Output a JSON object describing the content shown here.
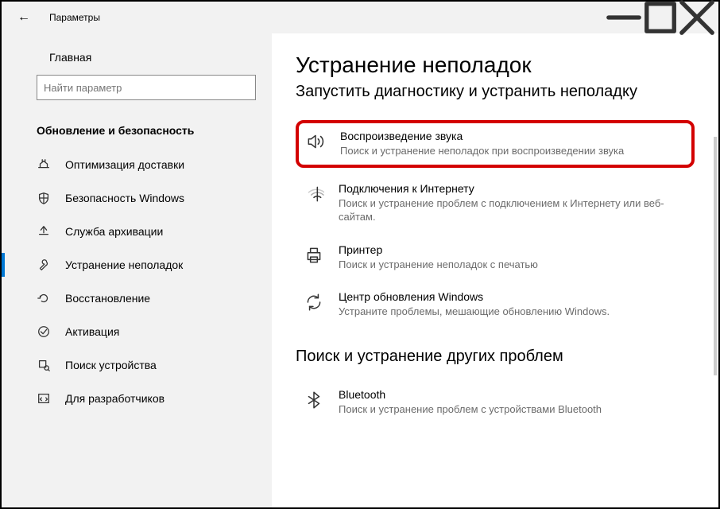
{
  "titlebar": {
    "title": "Параметры"
  },
  "sidebar": {
    "home_label": "Главная",
    "search_placeholder": "Найти параметр",
    "section": "Обновление и безопасность",
    "items": [
      {
        "label": "Оптимизация доставки"
      },
      {
        "label": "Безопасность Windows"
      },
      {
        "label": "Служба архивации"
      },
      {
        "label": "Устранение неполадок"
      },
      {
        "label": "Восстановление"
      },
      {
        "label": "Активация"
      },
      {
        "label": "Поиск устройства"
      },
      {
        "label": "Для разработчиков"
      }
    ]
  },
  "main": {
    "title": "Устранение неполадок",
    "subtitle": "Запустить диагностику и устранить неполадку",
    "troubleshooters": [
      {
        "title": "Воспроизведение звука",
        "desc": "Поиск и устранение неполадок при воспроизведении звука"
      },
      {
        "title": "Подключения к Интернету",
        "desc": "Поиск и устранение проблем с подключением к Интернету или веб-сайтам."
      },
      {
        "title": "Принтер",
        "desc": "Поиск и устранение неполадок с печатью"
      },
      {
        "title": "Центр обновления Windows",
        "desc": "Устраните проблемы, мешающие обновлению Windows."
      }
    ],
    "other_title": "Поиск и устранение других проблем",
    "other": [
      {
        "title": "Bluetooth",
        "desc": "Поиск и устранение проблем с устройствами Bluetooth"
      }
    ]
  }
}
